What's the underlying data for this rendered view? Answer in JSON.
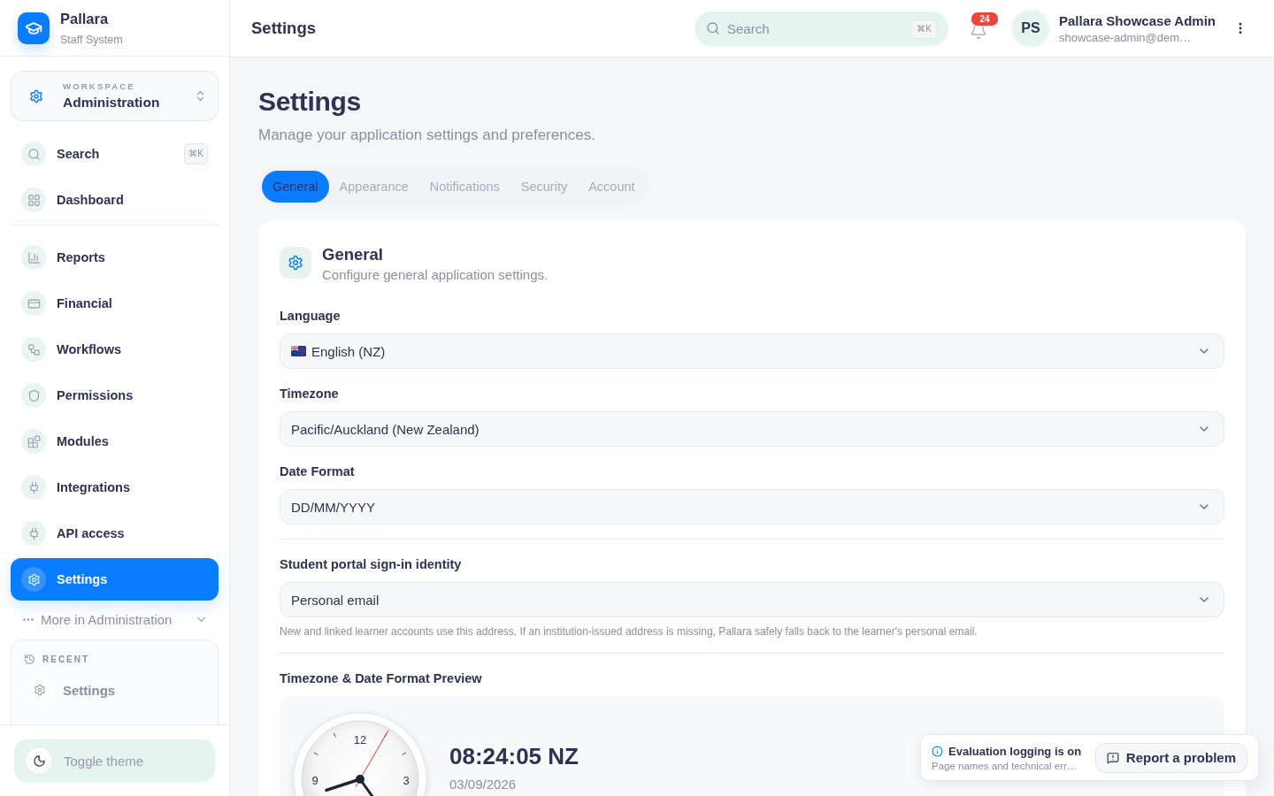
{
  "sidebar": {
    "brand": {
      "name": "Pallara",
      "subtitle": "Staff System"
    },
    "workspace": {
      "caption": "WORKSPACE",
      "name": "Administration"
    },
    "nav_groups": [
      [
        {
          "label": "Search",
          "shortcut": "⌘K",
          "selected": false
        },
        {
          "label": "Dashboard",
          "selected": false
        }
      ],
      [
        {
          "label": "Reports",
          "selected": false
        },
        {
          "label": "Financial",
          "selected": false
        },
        {
          "label": "Workflows",
          "selected": false
        },
        {
          "label": "Permissions",
          "selected": false
        },
        {
          "label": "Modules",
          "selected": false
        },
        {
          "label": "Integrations",
          "selected": false
        },
        {
          "label": "API access",
          "selected": false
        },
        {
          "label": "Settings",
          "selected": true
        }
      ]
    ],
    "more": {
      "label": "More in Administration",
      "expanded": false
    },
    "recent": {
      "title": "RECENT",
      "items": [
        {
          "label": "Settings"
        }
      ]
    },
    "theme_toggle": {
      "label": "Toggle theme"
    }
  },
  "header": {
    "title": "Settings",
    "search": {
      "placeholder": "Search",
      "shortcut": "⌘K"
    },
    "notifications": {
      "count": "24"
    },
    "user": {
      "initials": "PS",
      "name": "Pallara Showcase Admin",
      "email": "showcase-admin@dem…"
    }
  },
  "page": {
    "title": "Settings",
    "subtitle": "Manage your application settings and preferences.",
    "tabs": [
      {
        "label": "General",
        "selected": true
      },
      {
        "label": "Appearance",
        "selected": false
      },
      {
        "label": "Notifications",
        "selected": false
      },
      {
        "label": "Security",
        "selected": false
      },
      {
        "label": "Account",
        "selected": false
      }
    ]
  },
  "general": {
    "title": "General",
    "description": "Configure general application settings.",
    "field_groups": [
      [
        {
          "label": "Language",
          "value": "English (NZ)",
          "kind": "flag-select"
        },
        {
          "label": "Timezone",
          "value": "Pacific/Auckland (New Zealand)",
          "kind": "select"
        },
        {
          "label": "Date Format",
          "value": "DD/MM/YYYY",
          "kind": "select"
        }
      ],
      [
        {
          "label": "Student portal sign-in identity",
          "value": "Personal email",
          "kind": "select",
          "hint": "New and linked learner accounts use this address. If an institution-issued address is missing, Pallara safely falls back to the learner's personal email."
        }
      ]
    ],
    "preview": {
      "title": "Timezone & Date Format Preview",
      "clock_numerals": [
        "12",
        "3",
        "9"
      ],
      "time": "08:24:05 NZ",
      "date": "03/09/2026"
    }
  },
  "toast": {
    "title": "Evaluation logging is on",
    "message": "Page names and technical err…",
    "action": "Report a problem"
  }
}
